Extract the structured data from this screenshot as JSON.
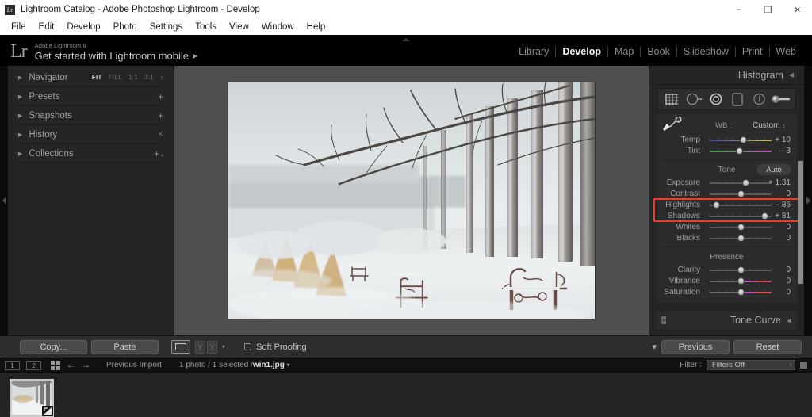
{
  "titlebar": {
    "app_icon": "lightroom-icon",
    "title": "Lightroom Catalog - Adobe Photoshop Lightroom - Develop",
    "minimize": "–",
    "maximize": "❐",
    "close": "✕"
  },
  "menubar": {
    "items": [
      "File",
      "Edit",
      "Develop",
      "Photo",
      "Settings",
      "Tools",
      "View",
      "Window",
      "Help"
    ]
  },
  "identity": {
    "logo": "Lr",
    "line1": "Adobe Lightroom 6",
    "line2": "Get started with Lightroom mobile",
    "arrow": "▶"
  },
  "modules": {
    "items": [
      {
        "label": "Library",
        "active": false
      },
      {
        "label": "Develop",
        "active": true
      },
      {
        "label": "Map",
        "active": false
      },
      {
        "label": "Book",
        "active": false
      },
      {
        "label": "Slideshow",
        "active": false
      },
      {
        "label": "Print",
        "active": false
      },
      {
        "label": "Web",
        "active": false
      }
    ]
  },
  "left_panel": {
    "rows": [
      {
        "label": "Navigator",
        "type": "zoom"
      },
      {
        "label": "Presets",
        "type": "plus"
      },
      {
        "label": "Snapshots",
        "type": "plus"
      },
      {
        "label": "History",
        "type": "close"
      },
      {
        "label": "Collections",
        "type": "plus-menu"
      }
    ],
    "zoom_levels": [
      {
        "label": "FIT",
        "active": true
      },
      {
        "label": "FILL",
        "active": false
      },
      {
        "label": "1:1",
        "active": false
      },
      {
        "label": "3:1",
        "active": false
      }
    ],
    "triangle": "▶",
    "plus": "+",
    "close_x": "✕",
    "stepper": "↕"
  },
  "right_panel": {
    "histogram_title": "Histogram",
    "collapse_arrow": "◀",
    "tools": [
      "crop-overlay-icon",
      "spot-removal-icon",
      "red-eye-icon",
      "graduated-filter-icon",
      "radial-filter-icon",
      "adjustment-brush-icon"
    ],
    "white_balance": {
      "eyedropper": "white-balance-selector-icon",
      "label": "WB :",
      "value": "Custom",
      "stepper": "↕",
      "sliders": [
        {
          "name": "Temp",
          "value": "+ 10",
          "pos": 55,
          "kind": "temp"
        },
        {
          "name": "Tint",
          "value": "– 3",
          "pos": 48,
          "kind": "tint"
        }
      ]
    },
    "tone": {
      "title": "Tone",
      "auto_label": "Auto",
      "sliders": [
        {
          "name": "Exposure",
          "value": "+ 1.31",
          "pos": 58,
          "highlighted": false
        },
        {
          "name": "Contrast",
          "value": "0",
          "pos": 50,
          "highlighted": false
        },
        {
          "name": "Highlights",
          "value": "– 86",
          "pos": 11,
          "highlighted": true
        },
        {
          "name": "Shadows",
          "value": "+ 81",
          "pos": 89,
          "highlighted": true
        },
        {
          "name": "Whites",
          "value": "0",
          "pos": 50,
          "highlighted": false
        },
        {
          "name": "Blacks",
          "value": "0",
          "pos": 50,
          "highlighted": false
        }
      ]
    },
    "presence": {
      "title": "Presence",
      "sliders": [
        {
          "name": "Clarity",
          "value": "0",
          "pos": 50,
          "kind": "plain"
        },
        {
          "name": "Vibrance",
          "value": "0",
          "pos": 50,
          "kind": "color"
        },
        {
          "name": "Saturation",
          "value": "0",
          "pos": 50,
          "kind": "color"
        }
      ]
    },
    "tone_curve": {
      "title": "Tone Curve",
      "collapse_arrow": "◀"
    },
    "highlight_box_color": "#e8402e"
  },
  "toolbar": {
    "copy_label": "Copy...",
    "paste_label": "Paste",
    "view_mode_icon": "loupe-view-icon",
    "before_after_labels": [
      "Y",
      "Y"
    ],
    "before_after_caret": "▾",
    "soft_proofing_label": "Soft Proofing",
    "toolbar_caret": "▾",
    "previous_label": "Previous",
    "reset_label": "Reset"
  },
  "filmstrip_bar": {
    "screen_buttons": [
      "1",
      "2"
    ],
    "grid_icon": "grid-view-icon",
    "back_arrow": "←",
    "forward_arrow": "→",
    "source_label": "Previous Import",
    "selection_text": "1 photo / 1 selected /",
    "filename": "win1.jpg",
    "filename_caret": "▾",
    "filter_label": "Filter :",
    "filter_value": "Filters Off",
    "filter_stepper": "↕"
  },
  "filmstrip": {
    "thumbnail_badge": "crop-badge-icon"
  },
  "photo": {
    "name": "win1.jpg",
    "description": "Snowy park scene with bare trees and wrought-iron benches"
  }
}
